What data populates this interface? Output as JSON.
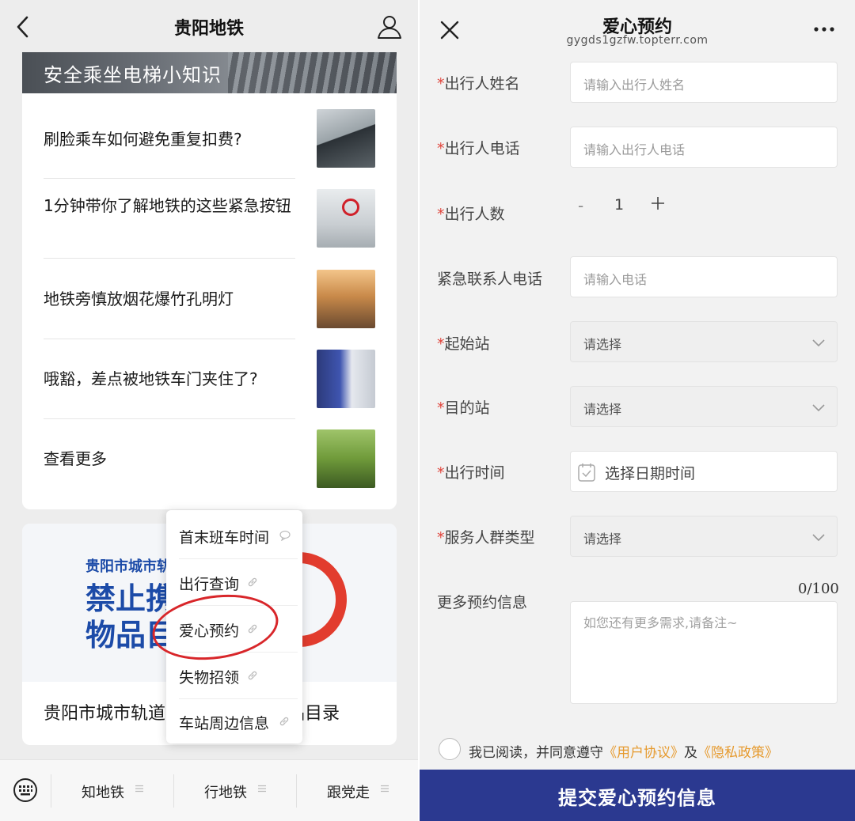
{
  "left": {
    "header": {
      "title": "贵阳地铁"
    },
    "banner": {
      "title": "安全乘坐电梯小知识"
    },
    "articles": [
      {
        "title": "刷脸乘车如何避免重复扣费?"
      },
      {
        "title": "1分钟带你了解地铁的这些紧急按钮"
      },
      {
        "title": "地铁旁慎放烟花爆竹孔明灯"
      },
      {
        "title": "哦豁，差点被地铁车门夹住了?"
      },
      {
        "title": "查看更多"
      }
    ],
    "poster": {
      "small": "贵阳市城市轨",
      "line1": "禁止携",
      "line2": "物品目",
      "caption": "贵阳市城市轨道交通禁止携带物品目录"
    },
    "popup_menu": {
      "items": [
        {
          "label": "首末班车时间",
          "icon": "bubble-icon"
        },
        {
          "label": "出行查询",
          "icon": "link-icon"
        },
        {
          "label": "爱心预约",
          "icon": "link-icon"
        },
        {
          "label": "失物招领",
          "icon": "link-icon"
        },
        {
          "label": "车站周边信息",
          "icon": "link-icon"
        }
      ]
    },
    "bottom_tabs": [
      {
        "label": "知地铁"
      },
      {
        "label": "行地铁"
      },
      {
        "label": "跟党走"
      }
    ]
  },
  "right": {
    "header": {
      "title": "爱心预约",
      "url": "gygds1gzfw.topterr.com"
    },
    "fields": {
      "name": {
        "label": "出行人姓名",
        "required": "*",
        "placeholder": "请输入出行人姓名"
      },
      "phone": {
        "label": "出行人电话",
        "required": "*",
        "placeholder": "请输入出行人电话"
      },
      "count": {
        "label": "出行人数",
        "required": "*",
        "minus": "-",
        "value": "1"
      },
      "emergency": {
        "label": "紧急联系人电话",
        "placeholder": "请输入电话"
      },
      "start": {
        "label": "起始站",
        "required": "*",
        "placeholder": "请选择"
      },
      "dest": {
        "label": "目的站",
        "required": "*",
        "placeholder": "请选择"
      },
      "time": {
        "label": "出行时间",
        "required": "*",
        "placeholder": "选择日期时间"
      },
      "group": {
        "label": "服务人群类型",
        "required": "*",
        "placeholder": "请选择"
      },
      "more": {
        "label": "更多预约信息",
        "counter": "0/100",
        "placeholder": "如您还有更多需求,请备注~"
      }
    },
    "agreement": {
      "prefix": "我已阅读，并同意遵守",
      "user_agreement": "《用户协议》",
      "and": "及",
      "privacy": "《隐私政策》"
    },
    "submit": {
      "label": "提交爱心预约信息"
    },
    "colors": {
      "accent": "#2b3990",
      "required": "#e0433a",
      "link": "#e69a2e"
    }
  }
}
